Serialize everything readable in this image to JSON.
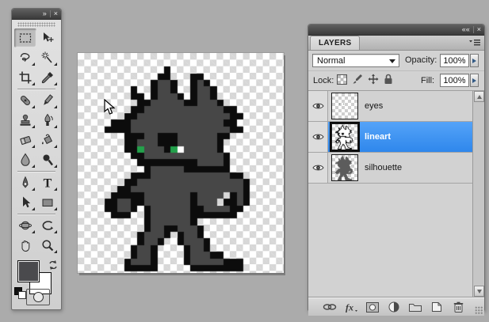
{
  "app": {
    "background_color": "#ababab",
    "selection_blue": "#3e97f5"
  },
  "toolbox": {
    "collapse_icon": "»",
    "close_icon": "×",
    "tools": [
      {
        "name": "rectangular-marquee-tool",
        "selected": true,
        "flyout": false
      },
      {
        "name": "move-tool",
        "selected": false,
        "flyout": false
      },
      {
        "name": "lasso-tool",
        "selected": false,
        "flyout": true
      },
      {
        "name": "magic-wand-tool",
        "selected": false,
        "flyout": true
      },
      {
        "name": "crop-tool",
        "selected": false,
        "flyout": true
      },
      {
        "name": "eyedropper-tool",
        "selected": false,
        "flyout": true
      },
      {
        "name": "healing-brush-tool",
        "selected": false,
        "flyout": true
      },
      {
        "name": "pencil-tool",
        "selected": false,
        "flyout": true
      },
      {
        "name": "clone-stamp-tool",
        "selected": false,
        "flyout": true
      },
      {
        "name": "history-brush-tool",
        "selected": false,
        "flyout": true
      },
      {
        "name": "eraser-tool",
        "selected": false,
        "flyout": true
      },
      {
        "name": "paint-bucket-tool",
        "selected": false,
        "flyout": true
      },
      {
        "name": "blur-tool",
        "selected": false,
        "flyout": true
      },
      {
        "name": "dodge-tool",
        "selected": false,
        "flyout": true
      },
      {
        "name": "pen-tool",
        "selected": false,
        "flyout": true
      },
      {
        "name": "type-tool",
        "selected": false,
        "flyout": true
      },
      {
        "name": "path-selection-tool",
        "selected": false,
        "flyout": true
      },
      {
        "name": "rectangle-tool",
        "selected": false,
        "flyout": true
      },
      {
        "name": "rotate-3d-tool",
        "selected": false,
        "flyout": true
      },
      {
        "name": "orbit-3d-tool",
        "selected": false,
        "flyout": true
      },
      {
        "name": "hand-tool",
        "selected": false,
        "flyout": false
      },
      {
        "name": "zoom-tool",
        "selected": false,
        "flyout": true
      }
    ],
    "foreground_color": "#4a4a4d",
    "background_color": "#ffffff"
  },
  "sprite": {
    "palette": {
      "k": "#0c0c0c",
      "g": "#474747",
      "e": "#23a14b",
      "w": "#ffffff"
    },
    "cell_size": 8.35,
    "rows": [
      "............................",
      "...........k................",
      "..........kk...kk...........",
      ".........kggk..kgk..........",
      "......k..kggk..kggk.........",
      "......kk.kgggk.kggk.........",
      ".......kkgggggkkgggk........",
      "......kkggggggggggggkk......",
      ".....kkggggggggggggggkk.....",
      "...kkkggggggggggggggkk......",
      "..kkkkgggggggggggggggkk.....",
      ".....kkkggkkkggggggkk.......",
      ".....kkgggkkkggggggk........",
      ".....kkegggkewgggggk........",
      "......kkggggggggggggk.......",
      ".......kkkkkkkkkggggk.......",
      "........kgggggkkkkkkk.......",
      "......kkkggggggggggggkk.....",
      ".....kkggggggggggggggggk....",
      "....kkgggggggggggggggggk....",
      "...kkkkkgggggggkgggg.kgk....",
      "..kkggkkgggggggkggg.kkgk....",
      "..kkggk.kggggggkkggggkk.....",
      "...kkk..kggggggkkkkkkk......",
      "........kggggggk............",
      "........kggkkgggk...........",
      ".......kgggk.kggk...........",
      ".......kggk..kgggk..........",
      "......kggk....kggk..........",
      "......kggk....kgggkk........",
      ".....kgggk....kgggggkkk.....",
      ".....kkkkk.....kkkkkkkk....."
    ]
  },
  "layers_panel": {
    "title": "LAYERS",
    "collapse_icon": "««",
    "close_icon": "×",
    "blend_mode": {
      "value": "Normal"
    },
    "opacity": {
      "label": "Opacity:",
      "value": "100%"
    },
    "lock": {
      "label": "Lock:",
      "icons": [
        "lock-transparency-icon",
        "lock-paint-icon",
        "lock-position-icon",
        "lock-all-icon"
      ]
    },
    "fill": {
      "label": "Fill:",
      "value": "100%"
    },
    "layers": [
      {
        "name": "eyes",
        "visible": true,
        "selected": false,
        "thumb": "eyes"
      },
      {
        "name": "lineart",
        "visible": true,
        "selected": true,
        "thumb": "lineart"
      },
      {
        "name": "silhouette",
        "visible": true,
        "selected": false,
        "thumb": "silhouette"
      }
    ],
    "bottom_icons": [
      "link-layers-icon",
      "fx-layer-style-icon",
      "add-layer-mask-icon",
      "adjustment-layer-icon",
      "new-group-icon",
      "new-layer-icon",
      "delete-layer-icon"
    ],
    "fx_label": "fx"
  }
}
